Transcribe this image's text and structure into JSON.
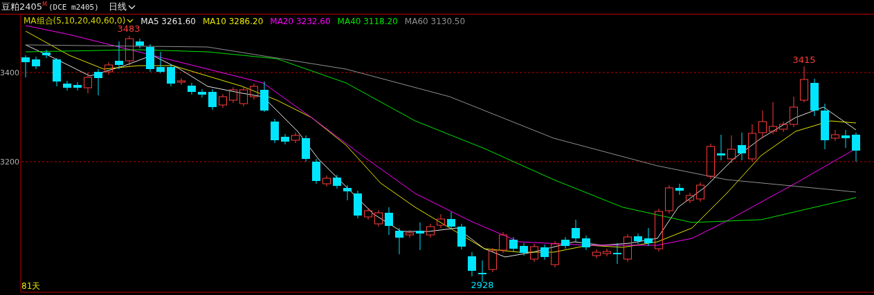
{
  "header": {
    "symbol": "豆粕2405",
    "badge": "M",
    "code": "(DCE m2405)",
    "period": "日线"
  },
  "legend": {
    "title": "MA组合(5,10,20,40,60,0)",
    "items": [
      {
        "label": "MA5",
        "value": "3261.60",
        "color": "#e6e6e6"
      },
      {
        "label": "MA10",
        "value": "3286.20",
        "color": "#e6e600"
      },
      {
        "label": "MA20",
        "value": "3232.60",
        "color": "#ff00ff"
      },
      {
        "label": "MA40",
        "value": "3118.20",
        "color": "#00e600"
      },
      {
        "label": "MA60",
        "value": "3130.50",
        "color": "#909090"
      }
    ]
  },
  "chart": {
    "y_axis_labels": [
      "3400",
      "3200"
    ],
    "annotations": [
      {
        "kind": "high",
        "label": "3483"
      },
      {
        "kind": "high",
        "label": "3415"
      },
      {
        "kind": "low",
        "label": "2928"
      }
    ],
    "day_count": "81天"
  }
}
